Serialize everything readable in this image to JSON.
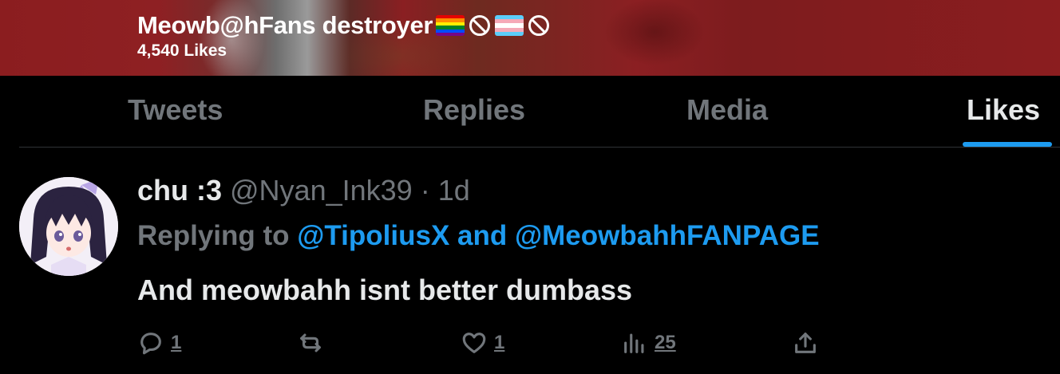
{
  "profile": {
    "display_name": "Meowb@hFans destroyer",
    "likes_count": "4,540 Likes",
    "header_emojis": [
      "rainbow-flag",
      "prohibited",
      "transgender-flag",
      "prohibited"
    ]
  },
  "tabs": [
    {
      "label": "Tweets",
      "active": false
    },
    {
      "label": "Replies",
      "active": false
    },
    {
      "label": "Media",
      "active": false
    },
    {
      "label": "Likes",
      "active": true
    }
  ],
  "tweet": {
    "author_name": "chu :3",
    "author_handle": "@Nyan_Ink39",
    "separator": "·",
    "time": "1d",
    "replying_prefix": "Replying to",
    "reply_to_1": "@TipoliusX",
    "reply_and": "and",
    "reply_to_2": "@MeowbahhFANPAGE",
    "text": "And meowbahh isnt better dumbass",
    "actions": {
      "reply_count": "1",
      "retweet_count": "",
      "like_count": "1",
      "views_count": "25"
    }
  },
  "colors": {
    "accent": "#1d9bf0",
    "muted": "#71767b",
    "text": "#e7e9ea",
    "banner": "#8b1d1f"
  }
}
